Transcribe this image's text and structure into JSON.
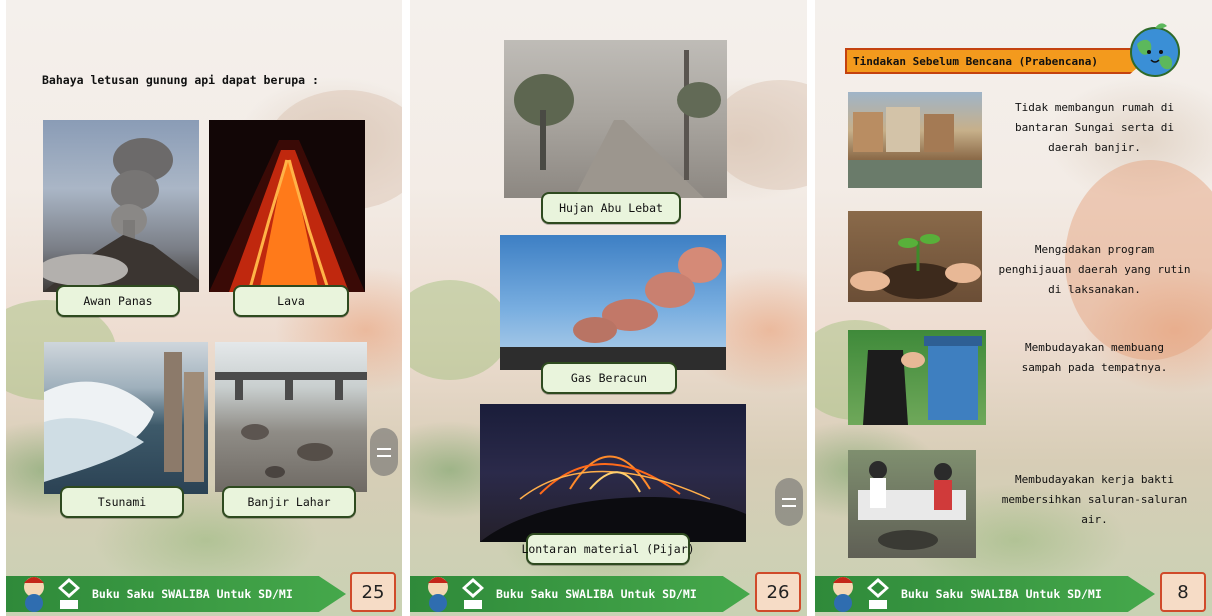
{
  "footer": {
    "book_title": "Buku Saku SWALIBA Untuk SD/MI"
  },
  "page1": {
    "heading": "Bahaya letusan gunung api dapat berupa :",
    "captions": [
      "Awan Panas",
      "Lava",
      "Tsunami",
      "Banjir Lahar"
    ],
    "page_number": "25"
  },
  "page2": {
    "captions": [
      "Hujan Abu Lebat",
      "Gas Beracun",
      "Lontaran material (Pijar)"
    ],
    "page_number": "26"
  },
  "page3": {
    "banner": "Tindakan Sebelum Bencana (Prabencana)",
    "items": [
      {
        "line1": "Tidak membangun rumah di",
        "line2": "bantaran Sungai serta di",
        "line3": "daerah banjir."
      },
      {
        "line1": "Mengadakan program",
        "line2": "penghijauan daerah yang rutin",
        "line3": "di laksanakan."
      },
      {
        "line1": "Membudayakan membuang",
        "line2": "sampah pada tempatnya.",
        "line3": ""
      },
      {
        "line1": "Membudayakan kerja bakti",
        "line2": "membersihkan saluran-saluran",
        "line3": "air."
      }
    ],
    "page_number": "8"
  },
  "colors": {
    "footer_green": "#3f9d45",
    "banner_orange": "#f39a1d",
    "caption_fill": "#e9f4dc",
    "page_number_fill": "#f6dcc6"
  },
  "icons": [
    "menu-icon",
    "mascot-logo-icon",
    "uin-logo-icon",
    "globe-icon"
  ]
}
